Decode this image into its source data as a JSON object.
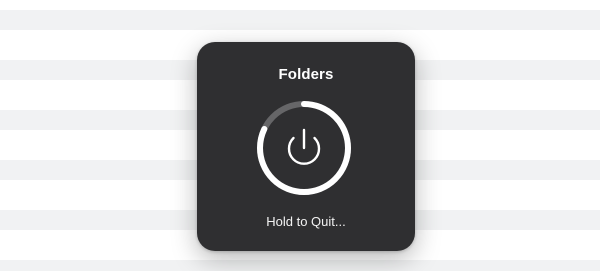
{
  "hud": {
    "title": "Folders",
    "message": "Hold to Quit...",
    "progress": 0.82,
    "icon": "power-icon",
    "colors": {
      "panel": "#2f2f31",
      "ring_track": "#666668",
      "ring_fill": "#ffffff",
      "text": "#ffffff"
    }
  }
}
